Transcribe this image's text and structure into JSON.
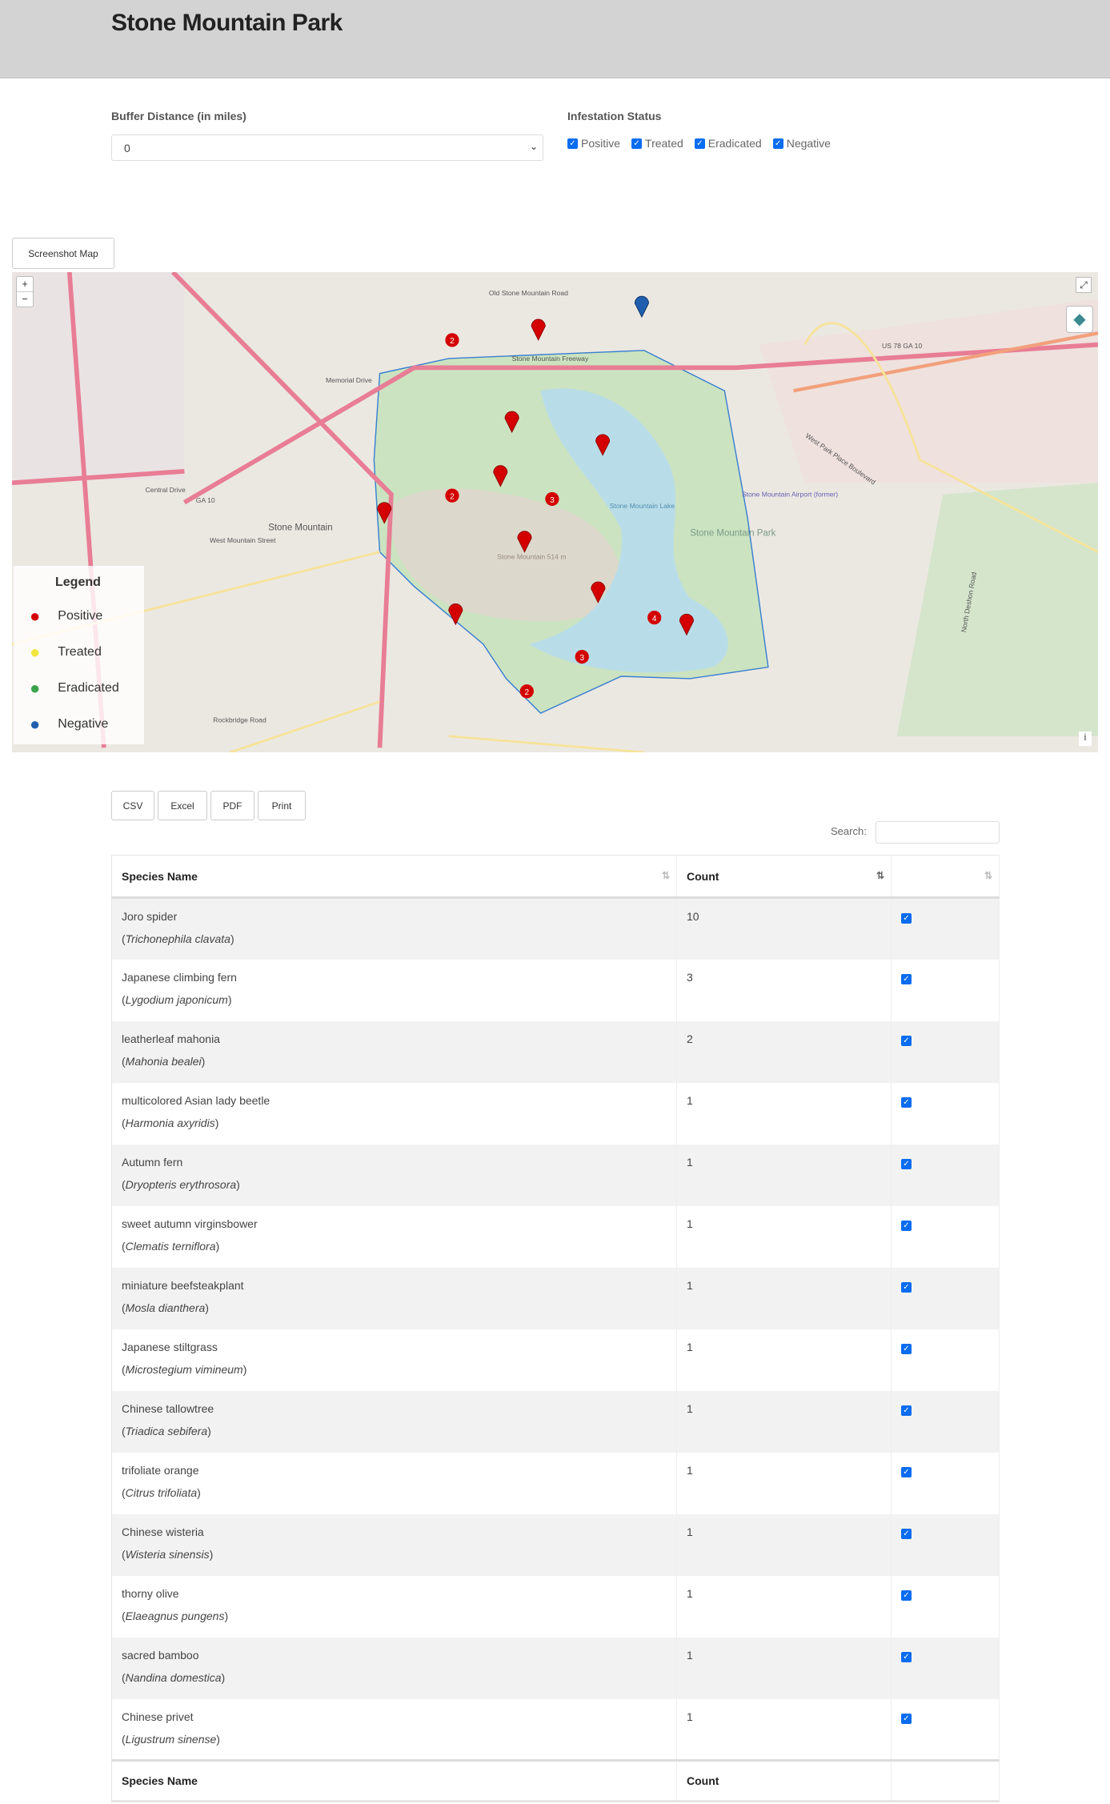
{
  "header": {
    "title": "Stone Mountain Park"
  },
  "filters": {
    "buffer_label": "Buffer Distance (in miles)",
    "buffer_value": "0",
    "status_label": "Infestation Status",
    "statuses": [
      {
        "label": "Positive",
        "checked": true
      },
      {
        "label": "Treated",
        "checked": true
      },
      {
        "label": "Eradicated",
        "checked": true
      },
      {
        "label": "Negative",
        "checked": true
      }
    ]
  },
  "map": {
    "screenshot_button": "Screenshot Map",
    "zoom_in": "+",
    "zoom_out": "−",
    "fullscreen_icon": "expand-icon",
    "layers_icon": "layers-icon",
    "info": "i",
    "legend": {
      "title": "Legend",
      "items": [
        {
          "label": "Positive",
          "color": "#d40000"
        },
        {
          "label": "Treated",
          "color": "#f2e640"
        },
        {
          "label": "Eradicated",
          "color": "#3aa34a"
        },
        {
          "label": "Negative",
          "color": "#1f5fae"
        }
      ]
    },
    "clusters": [
      "2",
      "2",
      "3",
      "4",
      "3",
      "2"
    ],
    "labels": {
      "road1": "Old Stone Mountain Road",
      "road2": "Stone Mountain Freeway",
      "road3": "Memorial Drive",
      "hwy": "US 78 GA 10",
      "ga10": "GA 10",
      "town": "Stone Mountain",
      "park": "Stone Mountain Park",
      "lake": "Stone Mountain Lake",
      "peak": "Stone Mountain 514 m",
      "airport": "Stone Mountain Airport (former)",
      "central": "Central Drive",
      "wms": "West Mountain Street",
      "rock": "Rockbridge Road",
      "deshon": "North Deshon Road",
      "wpp": "West Park Place Boulevard"
    }
  },
  "export": {
    "csv": "CSV",
    "excel": "Excel",
    "pdf": "PDF",
    "print": "Print"
  },
  "search": {
    "label": "Search:",
    "value": ""
  },
  "table": {
    "columns": [
      "Species Name",
      "Count",
      ""
    ],
    "rows": [
      {
        "name": "Joro spider",
        "sci": "Trichonephila clavata",
        "count": "10",
        "checked": true
      },
      {
        "name": "Japanese climbing fern",
        "sci": "Lygodium japonicum",
        "count": "3",
        "checked": true
      },
      {
        "name": "leatherleaf mahonia",
        "sci": "Mahonia bealei",
        "count": "2",
        "checked": true
      },
      {
        "name": "multicolored Asian lady beetle",
        "sci": "Harmonia axyridis",
        "count": "1",
        "checked": true
      },
      {
        "name": "Autumn fern",
        "sci": "Dryopteris erythrosora",
        "count": "1",
        "checked": true
      },
      {
        "name": "sweet autumn virginsbower",
        "sci": "Clematis terniflora",
        "count": "1",
        "checked": true
      },
      {
        "name": "miniature beefsteakplant",
        "sci": "Mosla dianthera",
        "count": "1",
        "checked": true
      },
      {
        "name": "Japanese stiltgrass",
        "sci": "Microstegium vimineum",
        "count": "1",
        "checked": true
      },
      {
        "name": "Chinese tallowtree",
        "sci": "Triadica sebifera",
        "count": "1",
        "checked": true
      },
      {
        "name": "trifoliate orange",
        "sci": "Citrus trifoliata",
        "count": "1",
        "checked": true
      },
      {
        "name": "Chinese wisteria",
        "sci": "Wisteria sinensis",
        "count": "1",
        "checked": true
      },
      {
        "name": "thorny olive",
        "sci": "Elaeagnus pungens",
        "count": "1",
        "checked": true
      },
      {
        "name": "sacred bamboo",
        "sci": "Nandina domestica",
        "count": "1",
        "checked": true
      },
      {
        "name": "Chinese privet",
        "sci": "Ligustrum sinense",
        "count": "1",
        "checked": true
      }
    ],
    "footer": [
      "Species Name",
      "Count",
      ""
    ]
  }
}
